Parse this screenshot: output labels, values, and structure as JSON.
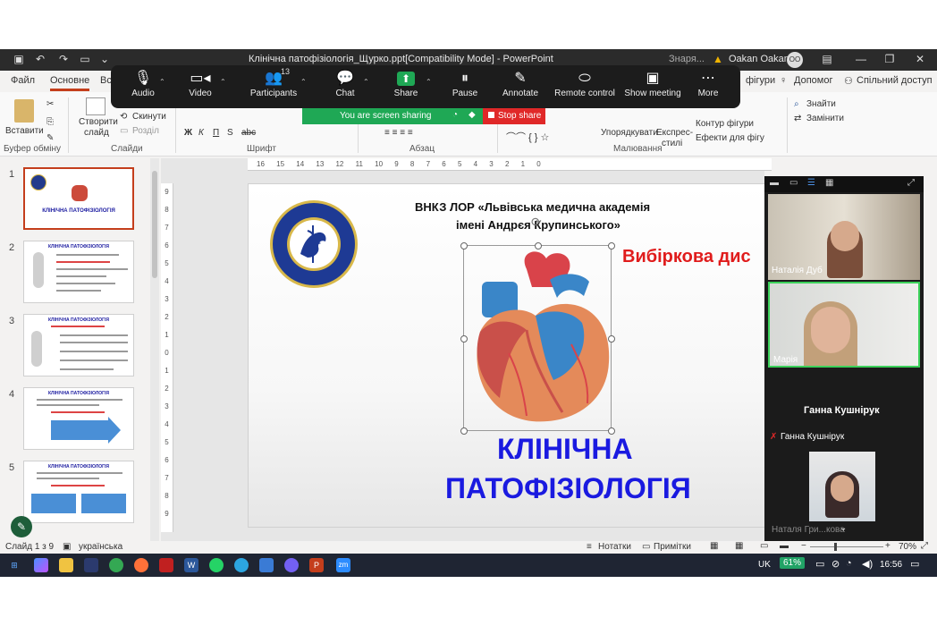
{
  "window": {
    "title": "Клінічна патофізіологія_Щурко.ppt[Compatibility Mode]  -  PowerPoint",
    "search_hint": "Знаря...",
    "user_name": "Oakan Oakan",
    "user_initials": "OO"
  },
  "ribbon_tabs": [
    "Файл",
    "Основне",
    "Вс"
  ],
  "ribbon_right": {
    "figures": "фігури",
    "help": "Допомог",
    "share": "Спільний доступ"
  },
  "ribbon": {
    "paste": "Вставити",
    "cut": "✂",
    "clipboard": "Буфер обміну",
    "new_slide_1": "Створити",
    "new_slide_2": "слайд",
    "reset": "Скинути",
    "section": "Розділ",
    "slides": "Слайди",
    "font": "Шрифт",
    "paragraph": "Абзац",
    "drawing": "Малювання",
    "arrange": "Упорядкувати",
    "quick_styles_1": "Експрес-",
    "quick_styles_2": "стилі",
    "shape_outline": "Контур фігури",
    "shape_effects": "Ефекти для фігу",
    "find": "Знайти",
    "replace": "Замінити",
    "font_bold": "Ж",
    "font_italic": "К",
    "font_underline": "П",
    "font_strike": "S",
    "font_abc": "abc"
  },
  "zoom_toolbar": {
    "participants_count": "13",
    "buttons": [
      {
        "label": "Audio",
        "icon": "microphone-icon"
      },
      {
        "label": "Video",
        "icon": "video-camera-icon"
      },
      {
        "label": "Participants",
        "icon": "participants-icon"
      },
      {
        "label": "Chat",
        "icon": "chat-icon"
      },
      {
        "label": "Share",
        "icon": "share-screen-icon"
      },
      {
        "label": "Pause",
        "icon": "pause-icon"
      },
      {
        "label": "Annotate",
        "icon": "pencil-icon"
      },
      {
        "label": "Remote control",
        "icon": "mouse-icon"
      },
      {
        "label": "Show meeting",
        "icon": "meeting-icon"
      },
      {
        "label": "More",
        "icon": "more-icon"
      }
    ],
    "sharing_status": "You are screen sharing",
    "stop_share": "Stop share"
  },
  "thumbnails": {
    "numbers": [
      "1",
      "2",
      "3",
      "4",
      "5"
    ],
    "titles": [
      "КЛІНІЧНА ПАТОФІЗІОЛОГІЯ",
      "КЛІНІЧНА ПАТОФІЗІОЛОГІЯ",
      "КЛІНІЧНА ПАТОФІЗІОЛОГІЯ",
      "КЛІНІЧНА ПАТОФІЗІОЛОГІЯ",
      "КЛІНІЧНА ПАТОФІЗІОЛОГІЯ"
    ]
  },
  "rulers": {
    "h_ticks": [
      "16",
      "15",
      "14",
      "13",
      "12",
      "11",
      "10",
      "9",
      "8",
      "7",
      "6",
      "5",
      "4",
      "3",
      "2",
      "1",
      "0"
    ],
    "v_ticks": [
      "9",
      "8",
      "7",
      "6",
      "5",
      "4",
      "3",
      "2",
      "1",
      "0",
      "1",
      "2",
      "3",
      "4",
      "5",
      "6",
      "7",
      "8",
      "9"
    ]
  },
  "slide": {
    "institution_line1": "ВНКЗ  ЛОР  «Львівська медична академія",
    "institution_line2": "імені Андрєя Крупинського»",
    "elective": "Вибіркова дис",
    "title_line1": "КЛІНІЧНА",
    "title_line2": "ПАТОФІЗІОЛОГІЯ",
    "logo_ring_top": "ЛЬВІВСЬКА МЕДИЧНА АКАДЕМІЯ",
    "logo_ring_bottom": "ІМ. АНДРЕЯ КРУПИНСЬКОГО"
  },
  "participants_panel": {
    "names": [
      "Наталія Дуб",
      "Марія",
      "Ганна Кушнірук",
      "Ганна Кушнірук",
      "Наталя Гри...кова"
    ]
  },
  "status_bar": {
    "slide_info": "Слайд 1 з 9",
    "language": "українська",
    "notes": "Нотатки",
    "comments": "Примітки",
    "zoom": "70%",
    "zoom_level": 0.7
  },
  "taskbar": {
    "language": "UK",
    "battery": "61%",
    "time": "16:56",
    "zm": "zm"
  },
  "colors": {
    "accent": "#c43e1c",
    "slide_title": "#1a1ae0",
    "slide_red": "#e01c1c",
    "zoom_green": "#1fa855"
  }
}
